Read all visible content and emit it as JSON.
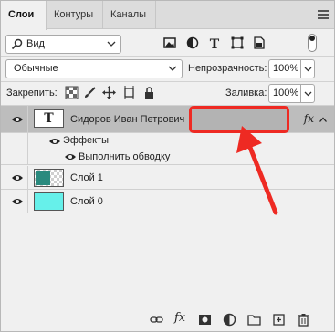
{
  "tabs": [
    {
      "label": "Слои",
      "active": true
    },
    {
      "label": "Контуры",
      "active": false
    },
    {
      "label": "Каналы",
      "active": false
    }
  ],
  "filter": {
    "kind_label": "Вид"
  },
  "blend": {
    "mode": "Обычные",
    "opacity_label": "Непрозрачность:",
    "opacity_value": "100%"
  },
  "lock": {
    "label": "Закрепить:",
    "fill_label": "Заливка:",
    "fill_value": "100%"
  },
  "layers": [
    {
      "name": "Сидоров Иван Петрович",
      "type": "text",
      "thumb_glyph": "T",
      "fx": "fx",
      "selected": true
    },
    {
      "name": "Слой 1",
      "type": "raster",
      "selected": false
    },
    {
      "name": "Слой 0",
      "type": "raster",
      "selected": false
    }
  ],
  "effects": {
    "group_label": "Эффекты",
    "items": [
      "Выполнить обводку"
    ]
  },
  "bottom_toolbar": {
    "fx_label": "fx"
  },
  "colors": {
    "annotation": "#ee2a23",
    "selected_row": "#bdbdbd",
    "layer0_fill": "#66f0ea"
  }
}
